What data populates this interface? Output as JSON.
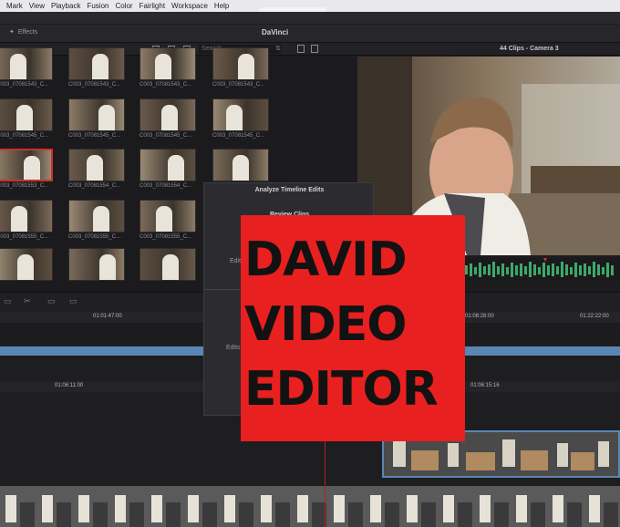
{
  "menu": [
    "Mark",
    "View",
    "Playback",
    "Fusion",
    "Color",
    "Fairlight",
    "Workspace",
    "Help"
  ],
  "toolbar": {
    "effects_label": "Effects",
    "app_title": "DaVinci"
  },
  "media_pool": {
    "search_placeholder": "Search",
    "thumbnails": [
      [
        "C003_07081543_C...",
        "C003_07081543_C...",
        "C003_07081543_C...",
        "C003_07081543_C..."
      ],
      [
        "C003_07081545_C...",
        "C003_07081545_C...",
        "C003_07081545_C...",
        "C003_07081545_C..."
      ],
      [
        "C003_07081553_C...",
        "C003_07081554_C...",
        "C003_07081554_C...",
        "C003_07081554_C..."
      ],
      [
        "C003_07081555_C...",
        "C003_07081555_C...",
        "C003_07081555_C...",
        "C003_07081555_C..."
      ],
      [
        "",
        "",
        "",
        ""
      ]
    ]
  },
  "viewer": {
    "title": "44 Clips - Camera 3"
  },
  "timeline": {
    "ruler1_left": "01:01:47:00",
    "ruler1_mid": "01:08:28:00",
    "ruler1_right": "01:22:22:00",
    "ruler2_left": "01:06:11:00",
    "ruler2_right": "01:06:15:16"
  },
  "dialog": {
    "title": "Analyze Timeline Edits",
    "subtitle": "Review Clips",
    "row1": "Edit",
    "row2": "Edits"
  },
  "banner": {
    "line1": "DAVID",
    "line2": "VIDEO",
    "line3": "EDITOR"
  },
  "colors": {
    "banner_red": "#e8201f",
    "timeline_blue": "#5a86b4",
    "selection_red": "#d0302a"
  }
}
